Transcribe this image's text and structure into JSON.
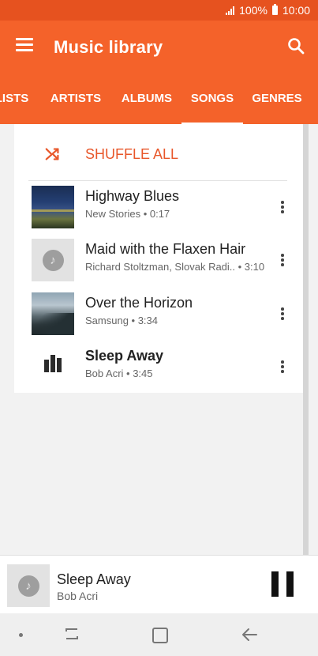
{
  "status_bar": {
    "battery_text": "100%",
    "time": "10:00"
  },
  "app_bar": {
    "title": "Music library",
    "menu_icon": "menu-icon",
    "search_icon": "search-icon"
  },
  "tabs": [
    {
      "label": "LISTS",
      "selected": false
    },
    {
      "label": "ARTISTS",
      "selected": false
    },
    {
      "label": "ALBUMS",
      "selected": false
    },
    {
      "label": "SONGS",
      "selected": true
    },
    {
      "label": "GENRES",
      "selected": false
    }
  ],
  "list": {
    "shuffle_label": "SHUFFLE ALL",
    "songs": [
      {
        "title": "Highway Blues",
        "subtitle": "New Stories • 0:17",
        "playing": false
      },
      {
        "title": "Maid with the Flaxen Hair",
        "subtitle": "Richard Stoltzman, Slovak Radi..  • 3:10",
        "playing": false
      },
      {
        "title": "Over the Horizon",
        "subtitle": "Samsung • 3:34",
        "playing": false
      },
      {
        "title": "Sleep Away",
        "subtitle": "Bob Acri • 3:45",
        "playing": true
      }
    ]
  },
  "mini_player": {
    "title": "Sleep Away",
    "artist": "Bob Acri"
  },
  "colors": {
    "app_bar": "#f4622a",
    "status_bar": "#e6521f",
    "accent_text": "#e8572a"
  }
}
